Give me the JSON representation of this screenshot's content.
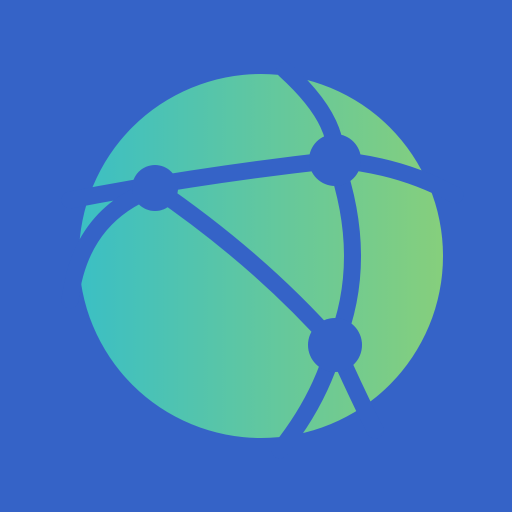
{
  "app_icon": {
    "icon": "network-globe-icon",
    "colors": {
      "background": "#3563c7",
      "globe_gradient_start": "#3bbfc4",
      "globe_gradient_end": "#86cf7c",
      "lines": "#3563c7"
    }
  }
}
